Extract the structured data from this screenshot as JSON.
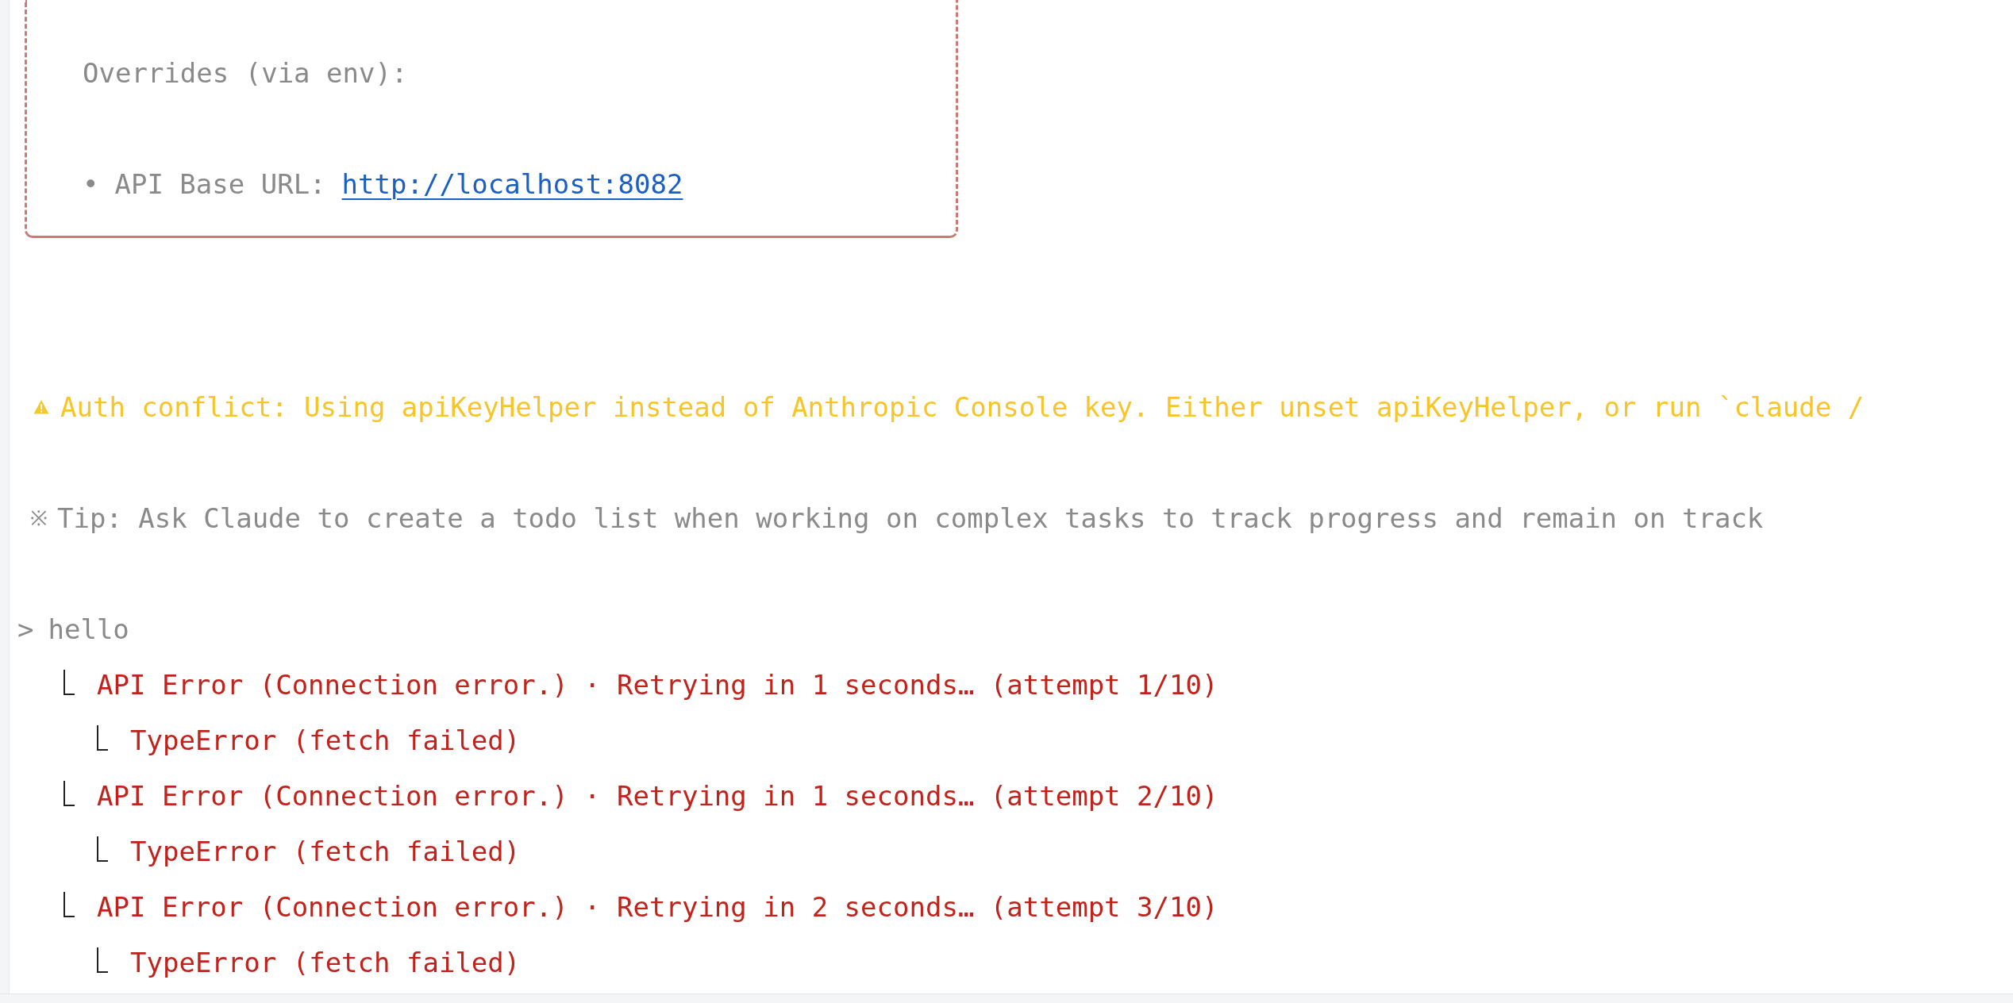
{
  "config_box": {
    "heading": "Overrides (via env):",
    "items": [
      {
        "bullet": "•",
        "label": "API Base URL:",
        "link": "http://localhost:8082"
      }
    ]
  },
  "warning": {
    "text": "Auth conflict: Using apiKeyHelper instead of Anthropic Console key. Either unset apiKeyHelper, or run `claude /"
  },
  "tip": {
    "marker": "※",
    "text": "Tip: Ask Claude to create a todo list when working on complex tasks to track progress and remain on track"
  },
  "prompt": {
    "symbol": ">",
    "text": "hello"
  },
  "log": [
    {
      "text": "API Error (Connection error.) · Retrying in 1 seconds… (attempt 1/10)",
      "children": [
        {
          "text": "TypeError (fetch failed)"
        }
      ]
    },
    {
      "text": "API Error (Connection error.) · Retrying in 1 seconds… (attempt 2/10)",
      "children": [
        {
          "text": "TypeError (fetch failed)"
        }
      ]
    },
    {
      "text": "API Error (Connection error.) · Retrying in 2 seconds… (attempt 3/10)",
      "children": [
        {
          "text": "TypeError (fetch failed)"
        }
      ]
    }
  ]
}
